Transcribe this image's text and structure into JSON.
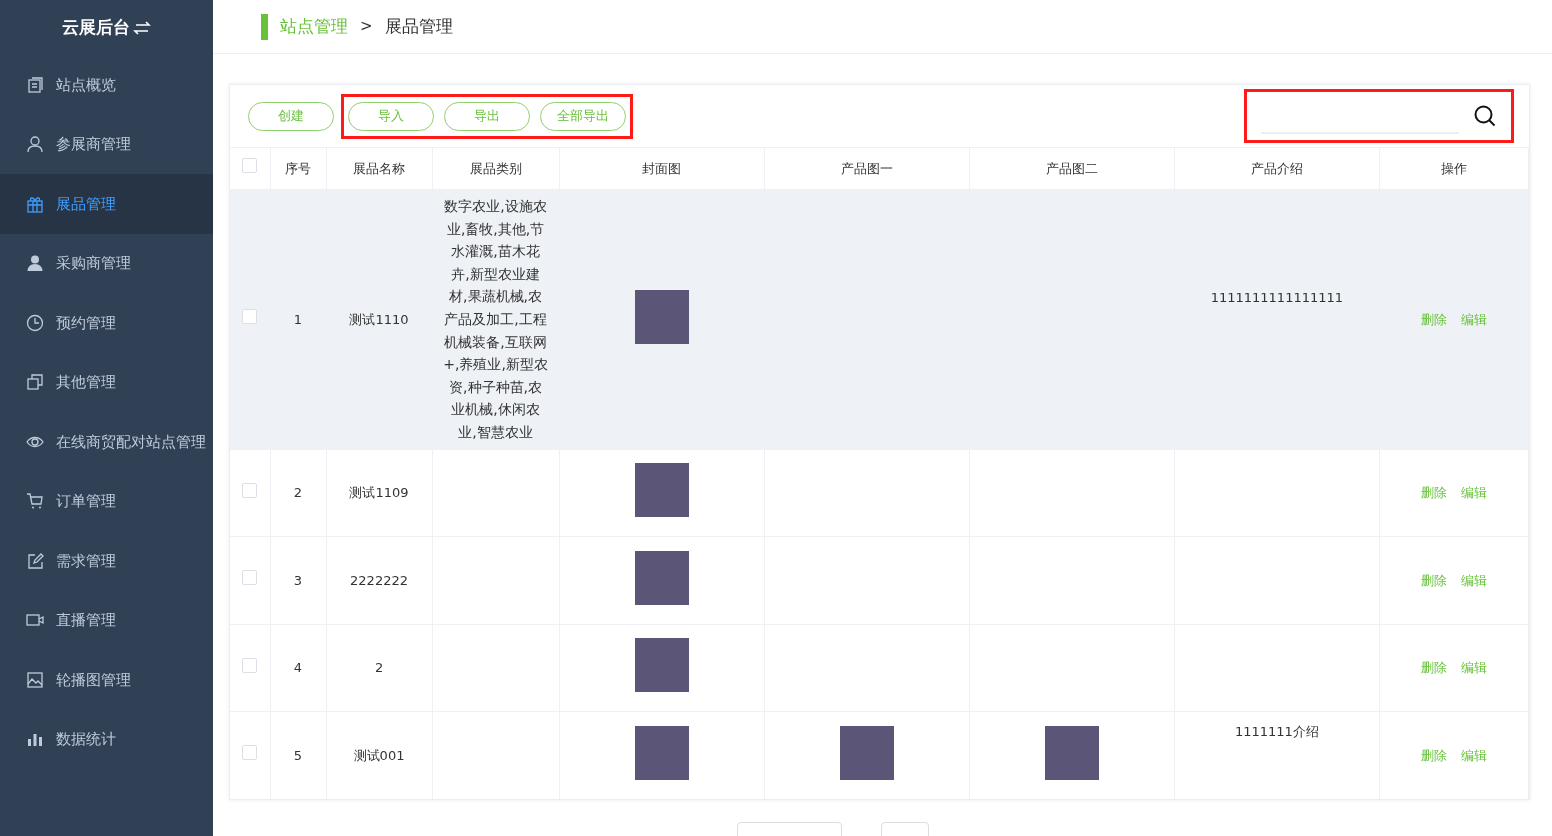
{
  "sidebar": {
    "title": "云展后台",
    "items": [
      {
        "label": "站点概览",
        "selected": false
      },
      {
        "label": "参展商管理",
        "selected": false
      },
      {
        "label": "展品管理",
        "selected": true
      },
      {
        "label": "采购商管理",
        "selected": false
      },
      {
        "label": "预约管理",
        "selected": false
      },
      {
        "label": "其他管理",
        "selected": false
      },
      {
        "label": "在线商贸配对站点管理",
        "selected": false
      },
      {
        "label": "订单管理",
        "selected": false
      },
      {
        "label": "需求管理",
        "selected": false
      },
      {
        "label": "直播管理",
        "selected": false
      },
      {
        "label": "轮播图管理",
        "selected": false
      },
      {
        "label": "数据统计",
        "selected": false
      }
    ]
  },
  "breadcrumb": {
    "parent": "站点管理",
    "separator": ">",
    "current": "展品管理"
  },
  "toolbar": {
    "buttons": [
      {
        "label": "创建",
        "highlighted": false
      },
      {
        "label": "导入",
        "highlighted": true
      },
      {
        "label": "导出",
        "highlighted": true
      },
      {
        "label": "全部导出",
        "highlighted": true
      }
    ],
    "search": {
      "highlighted": true
    }
  },
  "table": {
    "select_all_checked": false,
    "columns": [
      "序号",
      "展品名称",
      "展品类别",
      "封面图",
      "产品图一",
      "产品图二",
      "产品介绍",
      "操作"
    ],
    "rows": [
      {
        "checked": false,
        "hovered": true,
        "index": "1",
        "name": "测试1110",
        "category": "数字农业,设施农业,畜牧,其他,节水灌溉,苗木花卉,新型农业建材,果蔬机械,农产品及加工,工程机械装备,互联网+,养殖业,新型农资,种子种苗,农业机械,休闲农业,智慧农业",
        "cover": true,
        "image_1": false,
        "image_2": false,
        "intro": "1111111111111111",
        "actions": [
          "删除",
          "编辑"
        ]
      },
      {
        "checked": false,
        "hovered": false,
        "index": "2",
        "name": "测试1109",
        "cover": true,
        "image_1": false,
        "image_2": false,
        "actions": [
          "删除",
          "编辑"
        ]
      },
      {
        "checked": false,
        "hovered": false,
        "index": "3",
        "name": "2222222",
        "cover": true,
        "image_1": false,
        "image_2": false,
        "actions": [
          "删除",
          "编辑"
        ]
      },
      {
        "checked": false,
        "hovered": false,
        "index": "4",
        "name": "2",
        "cover": true,
        "image_1": false,
        "image_2": false,
        "actions": [
          "删除",
          "编辑"
        ]
      },
      {
        "checked": false,
        "hovered": false,
        "index": "5",
        "name": "测试001",
        "cover": true,
        "image_1": true,
        "image_2": true,
        "intro": "1111111介绍",
        "actions": [
          "删除",
          "编辑"
        ]
      }
    ]
  }
}
